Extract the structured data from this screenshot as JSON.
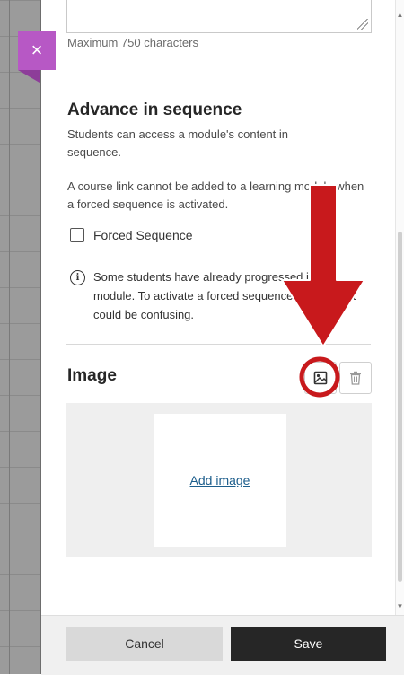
{
  "close": {
    "icon": "close-icon",
    "glyph": "×"
  },
  "description": {
    "char_limit": "Maximum 750 characters"
  },
  "sequence": {
    "title": "Advance in sequence",
    "description": "Students can access a module's content in sequence.",
    "note": "A course link cannot be added to a learning module when a forced sequence is activated.",
    "checkbox_label": "Forced Sequence",
    "checkbox_checked": false,
    "info_text": "Some students have already progressed in this module. To activate a forced sequence at this point could be confusing."
  },
  "image": {
    "title": "Image",
    "upload_icon": "image-upload-icon",
    "delete_icon": "trash-icon",
    "add_link": "Add image"
  },
  "footer": {
    "cancel_label": "Cancel",
    "save_label": "Save"
  },
  "colors": {
    "accent": "#b758c5",
    "save_bg": "#262626",
    "link": "#1d5e8c",
    "annotation_red": "#c8191c"
  }
}
